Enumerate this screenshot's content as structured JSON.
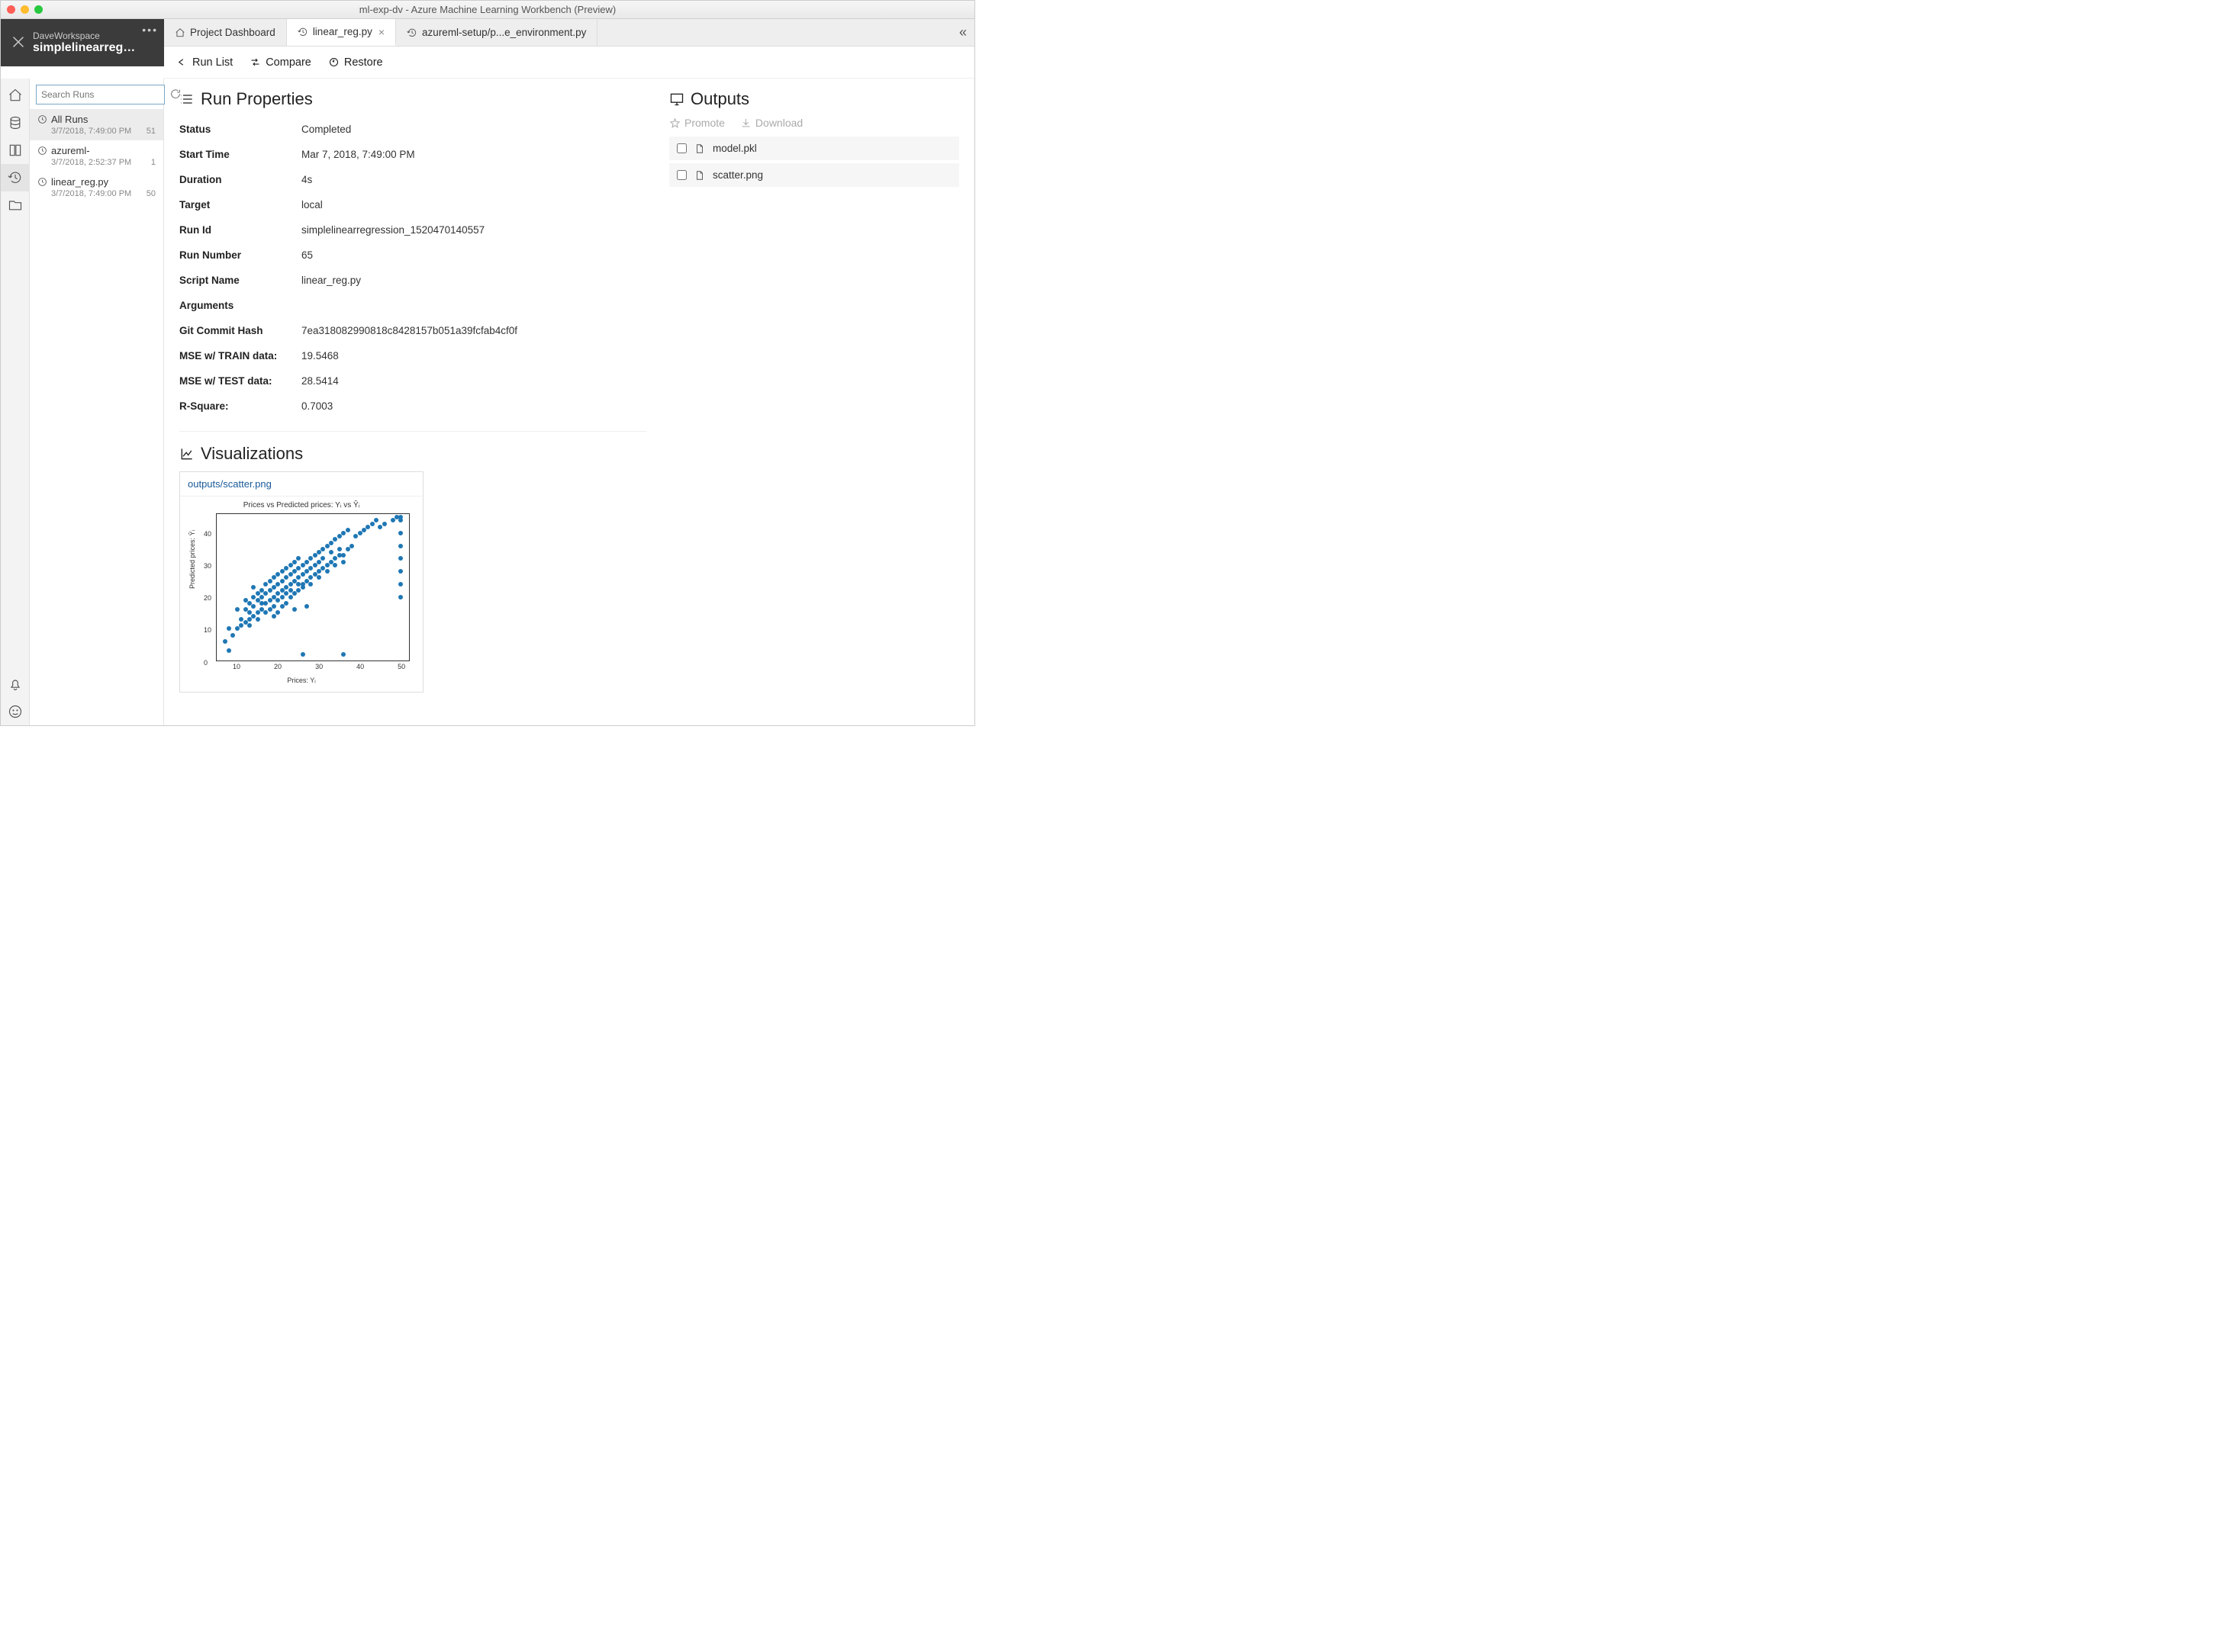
{
  "window": {
    "title": "ml-exp-dv - Azure Machine Learning Workbench (Preview)"
  },
  "project": {
    "workspace": "DaveWorkspace",
    "name": "simplelinearregres..."
  },
  "search": {
    "placeholder": "Search Runs"
  },
  "runs": [
    {
      "name": "All Runs",
      "time": "3/7/2018, 7:49:00 PM",
      "count": "51"
    },
    {
      "name": "azureml-",
      "time": "3/7/2018, 2:52:37 PM",
      "count": "1"
    },
    {
      "name": "linear_reg.py",
      "time": "3/7/2018, 7:49:00 PM",
      "count": "50"
    }
  ],
  "tabs": [
    {
      "label": "Project Dashboard",
      "icon": "home"
    },
    {
      "label": "linear_reg.py",
      "icon": "history",
      "active": true,
      "closable": true
    },
    {
      "label": "azureml-setup/p...e_environment.py",
      "icon": "history"
    }
  ],
  "toolbar": {
    "runlist": "Run List",
    "compare": "Compare",
    "restore": "Restore"
  },
  "sections": {
    "props": "Run Properties",
    "outputs": "Outputs",
    "viz": "Visualizations"
  },
  "props": [
    {
      "k": "Status",
      "v": "Completed"
    },
    {
      "k": "Start Time",
      "v": "Mar 7, 2018, 7:49:00 PM"
    },
    {
      "k": "Duration",
      "v": "4s"
    },
    {
      "k": "Target",
      "v": "local"
    },
    {
      "k": "Run Id",
      "v": "simplelinearregression_1520470140557"
    },
    {
      "k": "Run Number",
      "v": "65"
    },
    {
      "k": "Script Name",
      "v": "linear_reg.py"
    },
    {
      "k": "Arguments",
      "v": ""
    },
    {
      "k": "Git Commit Hash",
      "v": "7ea318082990818c8428157b051a39fcfab4cf0f"
    },
    {
      "k": "MSE w/ TRAIN data:",
      "v": "19.5468"
    },
    {
      "k": "MSE w/ TEST data:",
      "v": "28.5414"
    },
    {
      "k": "R-Square:",
      "v": "0.7003"
    }
  ],
  "outputs": {
    "promote": "Promote",
    "download": "Download",
    "files": [
      "model.pkl",
      "scatter.png"
    ]
  },
  "viz": {
    "file": "outputs/scatter.png"
  },
  "chart_data": {
    "type": "scatter",
    "title": "Prices vs Predicted prices: Yᵢ vs Ŷᵢ",
    "xlabel": "Prices: Yᵢ",
    "ylabel": "Predicted prices: Ŷᵢ",
    "xlim": [
      5,
      52
    ],
    "ylim": [
      -2,
      44
    ],
    "xticks": [
      10,
      20,
      30,
      40,
      50
    ],
    "yticks": [
      0,
      10,
      20,
      30,
      40
    ],
    "points": [
      [
        7,
        4
      ],
      [
        8,
        1
      ],
      [
        8,
        8
      ],
      [
        9,
        6
      ],
      [
        10,
        8
      ],
      [
        10,
        14
      ],
      [
        11,
        11
      ],
      [
        11,
        9
      ],
      [
        12,
        14
      ],
      [
        12,
        10
      ],
      [
        13,
        16
      ],
      [
        13,
        13
      ],
      [
        13,
        11
      ],
      [
        14,
        15
      ],
      [
        14,
        18
      ],
      [
        14,
        12
      ],
      [
        15,
        17
      ],
      [
        15,
        13
      ],
      [
        15,
        19
      ],
      [
        16,
        18
      ],
      [
        16,
        14
      ],
      [
        16,
        20
      ],
      [
        17,
        19
      ],
      [
        17,
        16
      ],
      [
        17,
        22
      ],
      [
        18,
        20
      ],
      [
        18,
        17
      ],
      [
        18,
        23
      ],
      [
        19,
        21
      ],
      [
        19,
        18
      ],
      [
        19,
        24
      ],
      [
        19,
        15
      ],
      [
        20,
        22
      ],
      [
        20,
        19
      ],
      [
        20,
        25
      ],
      [
        20,
        17
      ],
      [
        21,
        23
      ],
      [
        21,
        20
      ],
      [
        21,
        26
      ],
      [
        21,
        18
      ],
      [
        22,
        24
      ],
      [
        22,
        21
      ],
      [
        22,
        27
      ],
      [
        22,
        19
      ],
      [
        23,
        25
      ],
      [
        23,
        22
      ],
      [
        23,
        28
      ],
      [
        23,
        20
      ],
      [
        24,
        26
      ],
      [
        24,
        23
      ],
      [
        24,
        14
      ],
      [
        24,
        29
      ],
      [
        25,
        27
      ],
      [
        25,
        24
      ],
      [
        25,
        30
      ],
      [
        25,
        22
      ],
      [
        26,
        28
      ],
      [
        26,
        25
      ],
      [
        26,
        22
      ],
      [
        27,
        29
      ],
      [
        27,
        26
      ],
      [
        27,
        15
      ],
      [
        28,
        30
      ],
      [
        28,
        24
      ],
      [
        28,
        27
      ],
      [
        29,
        31
      ],
      [
        29,
        28
      ],
      [
        30,
        32
      ],
      [
        30,
        26
      ],
      [
        30,
        29
      ],
      [
        31,
        33
      ],
      [
        31,
        30
      ],
      [
        32,
        34
      ],
      [
        32,
        28
      ],
      [
        33,
        35
      ],
      [
        33,
        32
      ],
      [
        34,
        36
      ],
      [
        34,
        30
      ],
      [
        35,
        37
      ],
      [
        35,
        33
      ],
      [
        36,
        38
      ],
      [
        36,
        31
      ],
      [
        37,
        39
      ],
      [
        38,
        34
      ],
      [
        39,
        37
      ],
      [
        40,
        38
      ],
      [
        41,
        39
      ],
      [
        42,
        40
      ],
      [
        43,
        41
      ],
      [
        44,
        42
      ],
      [
        45,
        40
      ],
      [
        46,
        41
      ],
      [
        48,
        42
      ],
      [
        49,
        43
      ],
      [
        50,
        42
      ],
      [
        50,
        38
      ],
      [
        50,
        34
      ],
      [
        50,
        30
      ],
      [
        50,
        26
      ],
      [
        50,
        22
      ],
      [
        50,
        18
      ],
      [
        50,
        43
      ],
      [
        12,
        17
      ],
      [
        13,
        9
      ],
      [
        14,
        21
      ],
      [
        15,
        11
      ],
      [
        16,
        16
      ],
      [
        17,
        13
      ],
      [
        18,
        14
      ],
      [
        19,
        12
      ],
      [
        20,
        13
      ],
      [
        21,
        15
      ],
      [
        22,
        16
      ],
      [
        23,
        18
      ],
      [
        24,
        19
      ],
      [
        25,
        20
      ],
      [
        26,
        21
      ],
      [
        27,
        23
      ],
      [
        28,
        22
      ],
      [
        29,
        25
      ],
      [
        30,
        24
      ],
      [
        31,
        27
      ],
      [
        32,
        26
      ],
      [
        33,
        29
      ],
      [
        34,
        28
      ],
      [
        35,
        31
      ],
      [
        36,
        29
      ],
      [
        37,
        33
      ],
      [
        36,
        0
      ],
      [
        26,
        0
      ]
    ]
  }
}
